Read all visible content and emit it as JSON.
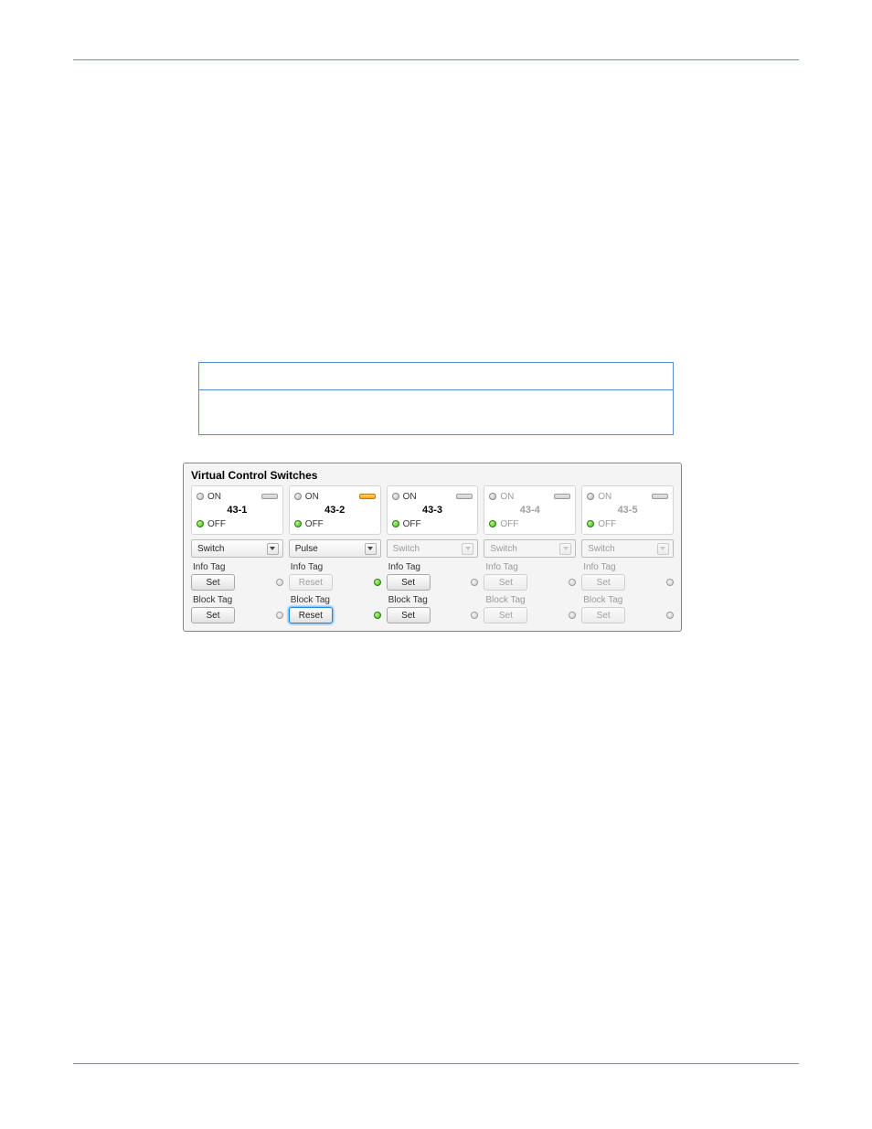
{
  "panel": {
    "title": "Virtual Control Switches",
    "info_tag_label": "Info Tag",
    "block_tag_label": "Block Tag",
    "switches": [
      {
        "id": "43-1",
        "on_label": "ON",
        "off_label": "OFF",
        "mode": "Switch",
        "enabled": true,
        "slot_color": "grey",
        "info_button": "Set",
        "info_status": "off",
        "block_button": "Set",
        "block_status": "off"
      },
      {
        "id": "43-2",
        "on_label": "ON",
        "off_label": "OFF",
        "mode": "Pulse",
        "enabled": true,
        "slot_color": "orange",
        "info_button": "Reset",
        "info_status": "on",
        "block_button": "Reset",
        "block_status": "on",
        "block_selected": true
      },
      {
        "id": "43-3",
        "on_label": "ON",
        "off_label": "OFF",
        "mode": "Switch",
        "enabled": true,
        "mode_disabled": true,
        "slot_color": "grey",
        "info_button": "Set",
        "info_status": "off",
        "block_button": "Set",
        "block_status": "off"
      },
      {
        "id": "43-4",
        "on_label": "ON",
        "off_label": "OFF",
        "mode": "Switch",
        "enabled": false,
        "slot_color": "grey",
        "info_button": "Set",
        "info_status": "off",
        "block_button": "Set",
        "block_status": "off"
      },
      {
        "id": "43-5",
        "on_label": "ON",
        "off_label": "OFF",
        "mode": "Switch",
        "enabled": false,
        "slot_color": "grey",
        "info_button": "Set",
        "info_status": "off",
        "block_button": "Set",
        "block_status": "off"
      }
    ]
  },
  "colors": {
    "rule": "#6a8fd8",
    "box_border": "#5b8ad6",
    "led_green": "#3db813",
    "slot_orange": "#ffa516"
  }
}
